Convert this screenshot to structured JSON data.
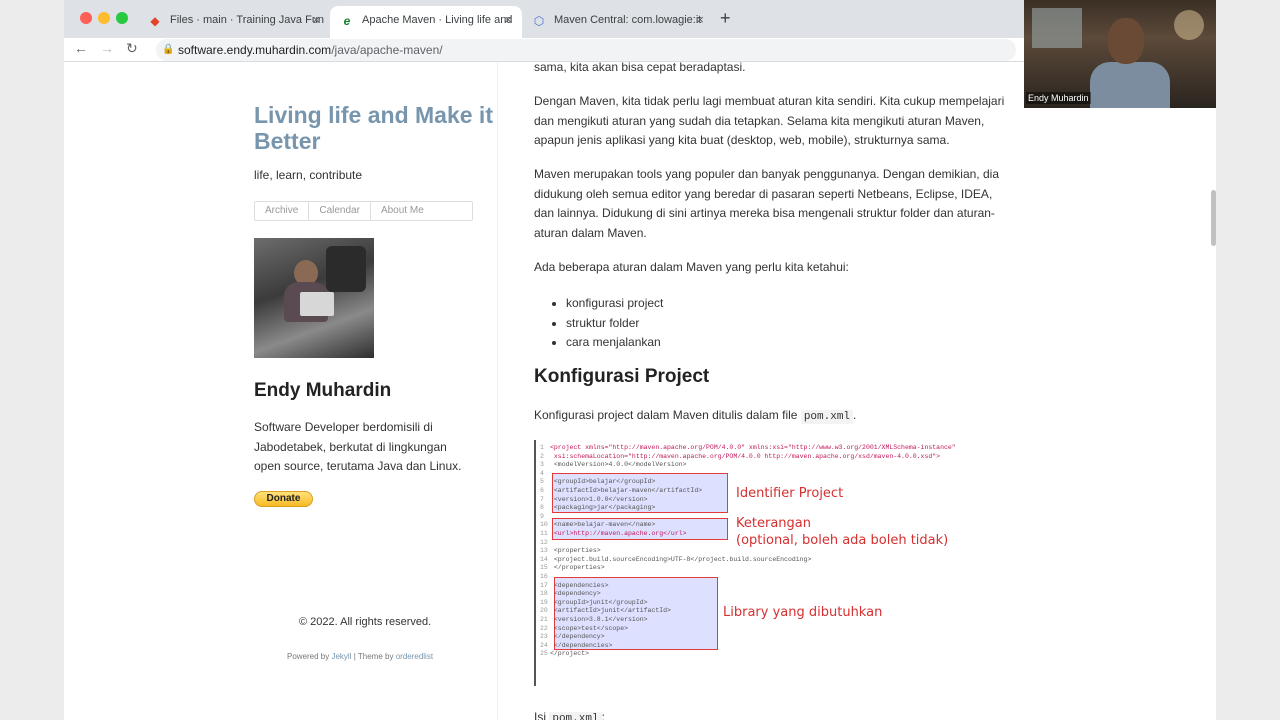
{
  "browser": {
    "tabs": [
      {
        "label": "Files · main · Training Java Fun",
        "favicon": "gitlab-icon",
        "active": false
      },
      {
        "label": "Apache Maven · Living life and",
        "favicon": "e-icon",
        "active": true
      },
      {
        "label": "Maven Central: com.lowagie:it",
        "favicon": "hexagon-icon",
        "active": false
      }
    ],
    "url_host": "software.endy.muhardin.com",
    "url_path": "/java/apache-maven/"
  },
  "sidebar": {
    "title": "Living life and Make it Better",
    "tagline": "life, learn, contribute",
    "nav": [
      "Archive",
      "Calendar",
      "About Me"
    ],
    "author": "Endy Muhardin",
    "bio": "Software Developer berdomisili di Jabodetabek, berkutat di lingkungan open source, terutama Java dan Linux.",
    "donate": "Donate",
    "copyright": "© 2022. All rights reserved.",
    "powered_prefix": "Powered by",
    "powered_jekyll": "Jekyll",
    "powered_theme": "| Theme by",
    "powered_theme_name": "orderedlist"
  },
  "content": {
    "p0": "sama, kita akan bisa cepat beradaptasi.",
    "p1": "Dengan Maven, kita tidak perlu lagi membuat aturan kita sendiri. Kita cukup mempelajari dan mengikuti aturan yang sudah dia tetapkan. Selama kita mengikuti aturan Maven, apapun jenis aplikasi yang kita buat (desktop, web, mobile), strukturnya sama.",
    "p2": "Maven merupakan tools yang populer dan banyak penggunanya. Dengan demikian, dia didukung oleh semua editor yang beredar di pasaran seperti Netbeans, Eclipse, IDEA, dan lainnya. Didukung di sini artinya mereka bisa mengenali struktur folder dan aturan-aturan dalam Maven.",
    "p3": "Ada beberapa aturan dalam Maven yang perlu kita ketahui:",
    "bullets": [
      "konfigurasi project",
      "struktur folder",
      "cara menjalankan"
    ],
    "heading": "Konfigurasi Project",
    "p4_text": "Konfigurasi project dalam Maven ditulis dalam file",
    "p4_code": "pom.xml",
    "p4_end": ".",
    "p5_text": "Isi",
    "p5_code": "pom.xml",
    "p5_end": ":",
    "code_lines": [
      {
        "n": "1",
        "t": "<project xmlns=\"http://maven.apache.org/POM/4.0.0\" xmlns:xsi=\"http://www.w3.org/2001/XMLSchema-instance\""
      },
      {
        "n": "2",
        "t": "  xsi:schemaLocation=\"http://maven.apache.org/POM/4.0.0 http://maven.apache.org/xsd/maven-4.0.0.xsd\">"
      },
      {
        "n": "3",
        "t": "  <modelVersion>4.0.0</modelVersion>"
      },
      {
        "n": "4",
        "t": ""
      },
      {
        "n": "5",
        "t": "  <groupId>belajar</groupId>"
      },
      {
        "n": "6",
        "t": "  <artifactId>belajar-maven</artifactId>"
      },
      {
        "n": "7",
        "t": "  <version>1.0.0</version>"
      },
      {
        "n": "8",
        "t": "  <packaging>jar</packaging>"
      },
      {
        "n": "9",
        "t": ""
      },
      {
        "n": "10",
        "t": "  <name>belajar-maven</name>"
      },
      {
        "n": "11",
        "t": "  <url>http://maven.apache.org</url>"
      },
      {
        "n": "12",
        "t": ""
      },
      {
        "n": "13",
        "t": "  <properties>"
      },
      {
        "n": "14",
        "t": "    <project.build.sourceEncoding>UTF-8</project.build.sourceEncoding>"
      },
      {
        "n": "15",
        "t": "  </properties>"
      },
      {
        "n": "16",
        "t": ""
      },
      {
        "n": "17",
        "t": "  <dependencies>"
      },
      {
        "n": "18",
        "t": "    <dependency>"
      },
      {
        "n": "19",
        "t": "      <groupId>junit</groupId>"
      },
      {
        "n": "20",
        "t": "      <artifactId>junit</artifactId>"
      },
      {
        "n": "21",
        "t": "      <version>3.8.1</version>"
      },
      {
        "n": "22",
        "t": "      <scope>test</scope>"
      },
      {
        "n": "23",
        "t": "    </dependency>"
      },
      {
        "n": "24",
        "t": "  </dependencies>"
      },
      {
        "n": "25",
        "t": "</project>"
      }
    ],
    "annotations": {
      "identifier": "Identifier Project",
      "keterangan": "Keterangan",
      "keterangan_sub": "(optional, boleh ada boleh tidak)",
      "library": "Library yang dibutuhkan"
    }
  },
  "webcam": {
    "name": "Endy Muhardin"
  },
  "colors": {
    "title": "#7796ad",
    "annotation": "#d62f2f",
    "box_fill": "#dde0ff"
  }
}
